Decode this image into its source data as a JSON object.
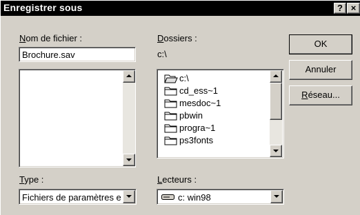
{
  "window": {
    "title": "Enregistrer sous",
    "help_button": "?",
    "close_button": "×"
  },
  "file_name": {
    "label_first": "N",
    "label_rest": "om de fichier :",
    "value": "Brochure.sav"
  },
  "folders": {
    "label_first": "D",
    "label_rest": "ossiers :",
    "current_path": "c:\\",
    "items": [
      {
        "name": "c:\\",
        "icon": "open-folder-icon"
      },
      {
        "name": "cd_ess~1",
        "icon": "folder-icon"
      },
      {
        "name": "mesdoc~1",
        "icon": "folder-icon"
      },
      {
        "name": "pbwin",
        "icon": "folder-icon"
      },
      {
        "name": "progra~1",
        "icon": "folder-icon"
      },
      {
        "name": "ps3fonts",
        "icon": "folder-icon"
      }
    ]
  },
  "buttons": {
    "ok": "OK",
    "cancel": "Annuler",
    "network_first": "R",
    "network_rest": "éseau..."
  },
  "type": {
    "label_first": "T",
    "label_rest": "ype :",
    "value": "Fichiers de paramètres e"
  },
  "drives": {
    "label_first": "L",
    "label_rest": "ecteurs :",
    "value": "c: win98",
    "icon": "drive-icon"
  }
}
